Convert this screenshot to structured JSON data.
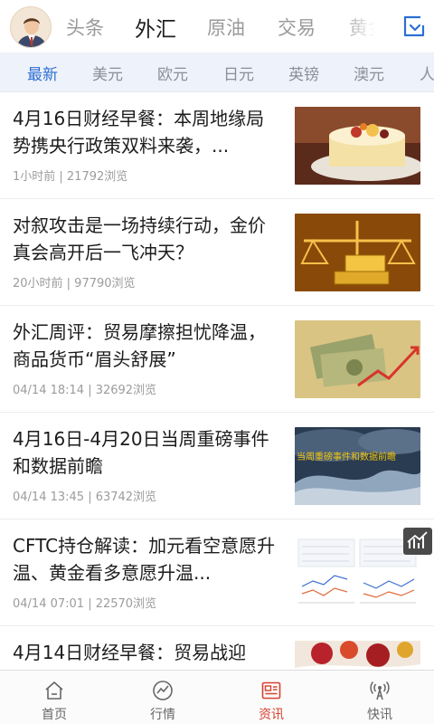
{
  "top_tabs": [
    "头条",
    "外汇",
    "原油",
    "交易",
    "黄金"
  ],
  "active_top_tab": "外汇",
  "sub_tabs": [
    "最新",
    "美元",
    "欧元",
    "日元",
    "英镑",
    "澳元",
    "人"
  ],
  "active_sub_tab": "最新",
  "articles": [
    {
      "title": "4月16日财经早餐：本周地缘局势携央行政策双料来袭，...",
      "meta": "1小时前 | 21792浏览",
      "thumb": "cake-photo"
    },
    {
      "title": "对叙攻击是一场持续行动，金价真会高开后一飞冲天？",
      "meta": "20小时前 | 97790浏览",
      "thumb": "gold-scale-photo"
    },
    {
      "title": "外汇周评：贸易摩擦担忧降温，商品货币“眉头舒展”",
      "meta": "04/14 18:14 | 32692浏览",
      "thumb": "dollar-chart-photo"
    },
    {
      "title": "4月16日-4月20日当周重磅事件和数据前瞻",
      "meta": "04/14 13:45 | 63742浏览",
      "thumb": "storm-photo",
      "thumb_caption": "当周重磅事件和数据前瞻"
    },
    {
      "title": "CFTC持仓解读：加元看空意愿升温、黄金看多意愿升温...",
      "meta": "04/14 07:01 | 22570浏览",
      "thumb": "cftc-charts"
    },
    {
      "title": "4月14日财经早餐：贸易战迎",
      "meta": "",
      "thumb": "fruit-photo"
    }
  ],
  "bottom_nav": [
    {
      "label": "首页",
      "icon": "home-icon"
    },
    {
      "label": "行情",
      "icon": "market-icon"
    },
    {
      "label": "资讯",
      "icon": "news-icon"
    },
    {
      "label": "快讯",
      "icon": "broadcast-icon"
    }
  ],
  "active_bottom_nav": "资讯",
  "colors": {
    "accent_blue": "#2d6fd3",
    "accent_red": "#d8412f",
    "subbar_bg": "#eef2fa"
  }
}
